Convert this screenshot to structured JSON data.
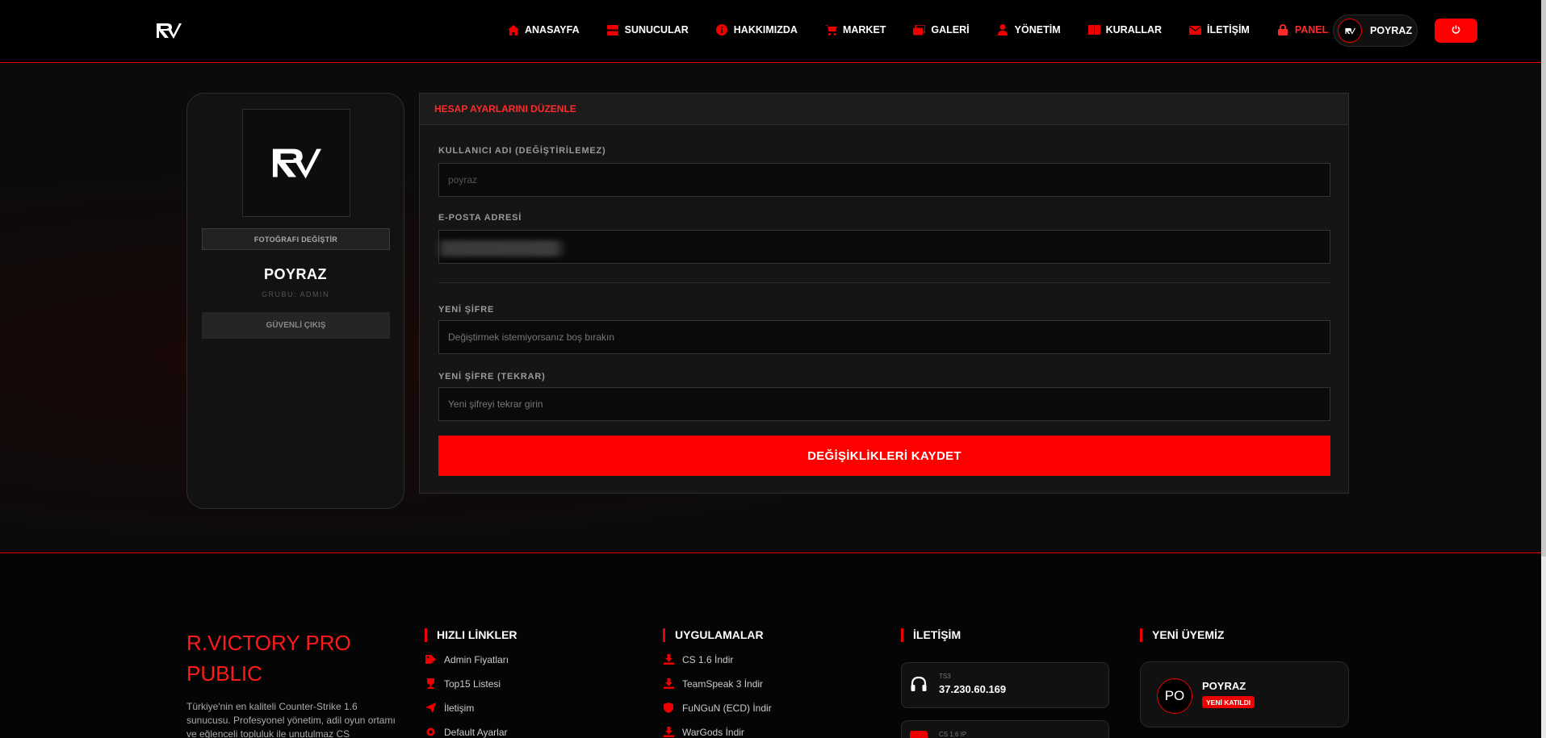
{
  "header": {
    "nav": [
      {
        "label": "ANASAYFA",
        "icon": "home-icon"
      },
      {
        "label": "SUNUCULAR",
        "icon": "server-icon"
      },
      {
        "label": "HAKKIMIZDA",
        "icon": "info-icon"
      },
      {
        "label": "MARKET",
        "icon": "cart-icon"
      },
      {
        "label": "GALERİ",
        "icon": "gallery-icon"
      },
      {
        "label": "YÖNETİM",
        "icon": "user-icon"
      },
      {
        "label": "KURALLAR",
        "icon": "book-icon"
      },
      {
        "label": "İLETİŞİM",
        "icon": "mail-icon"
      },
      {
        "label": "PANEL",
        "icon": "lock-icon"
      }
    ],
    "user_name": "POYRAZ",
    "accent": "#ff0000"
  },
  "sidebar": {
    "photo_button": "FOTOĞRAFI DEĞİŞTİR",
    "name": "POYRAZ",
    "group": "GRUBU: ADMIN",
    "logout": "GÜVENLİ ÇIKIŞ"
  },
  "form": {
    "title": "HESAP AYARLARINI DÜZENLE",
    "username_label": "KULLANICI ADI (DEĞİŞTİRİLEMEZ)",
    "username_value": "poyraz",
    "email_label": "E-POSTA ADRESİ",
    "new_password_label": "YENİ ŞİFRE",
    "new_password_placeholder": "Değiştirmek istemiyorsanız boş bırakın",
    "repeat_password_label": "YENİ ŞİFRE (TEKRAR)",
    "repeat_password_placeholder": "Yeni şifreyi tekrar girin",
    "save": "DEĞİŞİKLİKLERİ KAYDET"
  },
  "footer": {
    "brand_title": "R.VICTORY PRO PUBLIC",
    "brand_desc": "Türkiye'nin en kaliteli Counter-Strike 1.6 sunucusu. Profesyonel yönetim, adil oyun ortamı ve eğlenceli topluluk ile unutulmaz CS",
    "quick_links_title": "HIZLI LİNKLER",
    "quick_links": [
      {
        "label": "Admin Fiyatları",
        "icon": "tag-icon"
      },
      {
        "label": "Top15 Listesi",
        "icon": "trophy-icon"
      },
      {
        "label": "İletişim",
        "icon": "send-icon"
      },
      {
        "label": "Default Ayarlar",
        "icon": "settings-icon"
      }
    ],
    "apps_title": "UYGULAMALAR",
    "apps": [
      {
        "label": "CS 1.6 İndir",
        "icon": "download-icon"
      },
      {
        "label": "TeamSpeak 3 İndir",
        "icon": "download-icon"
      },
      {
        "label": "FuNGuN (ECD) İndir",
        "icon": "shield-icon"
      },
      {
        "label": "WarGods İndir",
        "icon": "download-icon"
      }
    ],
    "contact_title": "İLETİŞİM",
    "contacts": [
      {
        "label": "TS3",
        "value": "37.230.60.169",
        "icon": "headset-icon"
      },
      {
        "label": "CS 1.6 IP",
        "value": "",
        "icon": "server-icon"
      }
    ],
    "new_member_title": "YENİ ÜYEMİZ",
    "new_member": {
      "initials": "PO",
      "name": "POYRAZ",
      "badge": "YENİ KATILDI"
    }
  }
}
